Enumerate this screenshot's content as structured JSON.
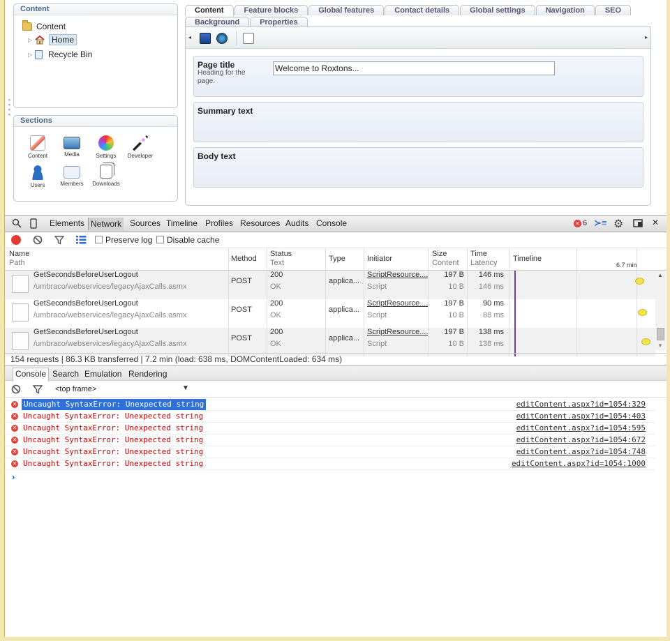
{
  "tree": {
    "header": "Content",
    "items": [
      {
        "label": "Content"
      },
      {
        "label": "Home"
      },
      {
        "label": "Recycle Bin"
      }
    ]
  },
  "sections": {
    "header": "Sections",
    "items": [
      {
        "label": "Content",
        "icon": "content-icon"
      },
      {
        "label": "Media",
        "icon": "media-icon"
      },
      {
        "label": "Settings",
        "icon": "settings-icon"
      },
      {
        "label": "Developer",
        "icon": "developer-icon"
      },
      {
        "label": "Users",
        "icon": "users-icon"
      },
      {
        "label": "Members",
        "icon": "members-icon"
      },
      {
        "label": "Downloads",
        "icon": "downloads-icon"
      }
    ]
  },
  "editor_tabs": {
    "row1": [
      "Content",
      "Feature blocks",
      "Global features",
      "Contact details",
      "Global settings",
      "Navigation",
      "SEO"
    ],
    "row2": [
      "Background",
      "Properties"
    ]
  },
  "properties": {
    "page_title": {
      "label": "Page title",
      "description": "Heading for the page.",
      "value": "Welcome to Roxtons..."
    },
    "summary_text": {
      "label": "Summary text"
    },
    "body_text": {
      "label": "Body text"
    }
  },
  "devtools": {
    "tabs": [
      "Elements",
      "Network",
      "Sources",
      "Timeline",
      "Profiles",
      "Resources",
      "Audits",
      "Console"
    ],
    "active_tab": "Network",
    "error_count": "6",
    "network_toolbar": {
      "preserve_log": "Preserve log",
      "disable_cache": "Disable cache"
    },
    "columns": {
      "name": "Name",
      "path": "Path",
      "method": "Method",
      "status": "Status",
      "text": "Text",
      "type": "Type",
      "initiator": "Initiator",
      "size": "Size",
      "content": "Content",
      "time": "Time",
      "latency": "Latency",
      "timeline": "Timeline",
      "timeline_scale": "6.7 min"
    },
    "rows": [
      {
        "name": "GetSecondsBeforeUserLogout",
        "path": "/umbraco/webservices/legacyAjaxCalls.asmx",
        "method": "POST",
        "status": "200",
        "text": "OK",
        "type": "applica...",
        "initiator": "ScriptResource....",
        "initiator_sub": "Script",
        "size": "197 B",
        "content": "10 B",
        "time": "146 ms",
        "latency": "146 ms"
      },
      {
        "name": "GetSecondsBeforeUserLogout",
        "path": "/umbraco/webservices/legacyAjaxCalls.asmx",
        "method": "POST",
        "status": "200",
        "text": "OK",
        "type": "applica...",
        "initiator": "ScriptResource....",
        "initiator_sub": "Script",
        "size": "197 B",
        "content": "10 B",
        "time": "90 ms",
        "latency": "88 ms"
      },
      {
        "name": "GetSecondsBeforeUserLogout",
        "path": "/umbraco/webservices/legacyAjaxCalls.asmx",
        "method": "POST",
        "status": "200",
        "text": "OK",
        "type": "applica...",
        "initiator": "ScriptResource....",
        "initiator_sub": "Script",
        "size": "197 B",
        "content": "10 B",
        "time": "138 ms",
        "latency": "138 ms"
      }
    ],
    "status_bar": "154 requests | 86.3 KB transferred | 7.2 min (load: 638 ms, DOMContentLoaded: 634 ms)",
    "drawer_tabs": [
      "Console",
      "Search",
      "Emulation",
      "Rendering"
    ],
    "frame_select": "<top frame>",
    "messages": [
      {
        "text": "Uncaught SyntaxError: Unexpected string",
        "source": "editContent.aspx?id=1054:329"
      },
      {
        "text": "Uncaught SyntaxError: Unexpected string",
        "source": "editContent.aspx?id=1054:403"
      },
      {
        "text": "Uncaught SyntaxError: Unexpected string",
        "source": "editContent.aspx?id=1054:595"
      },
      {
        "text": "Uncaught SyntaxError: Unexpected string",
        "source": "editContent.aspx?id=1054:672"
      },
      {
        "text": "Uncaught SyntaxError: Unexpected string",
        "source": "editContent.aspx?id=1054:748"
      },
      {
        "text": "Uncaught SyntaxError: Unexpected string",
        "source": "editContent.aspx?id=1054:1000"
      }
    ],
    "prompt": "›"
  },
  "colors": {
    "error": "#d20000",
    "highlight": "#2f6fd8",
    "timeline_marker": "#7a3b9a",
    "window_border": "#f4e6b0"
  }
}
